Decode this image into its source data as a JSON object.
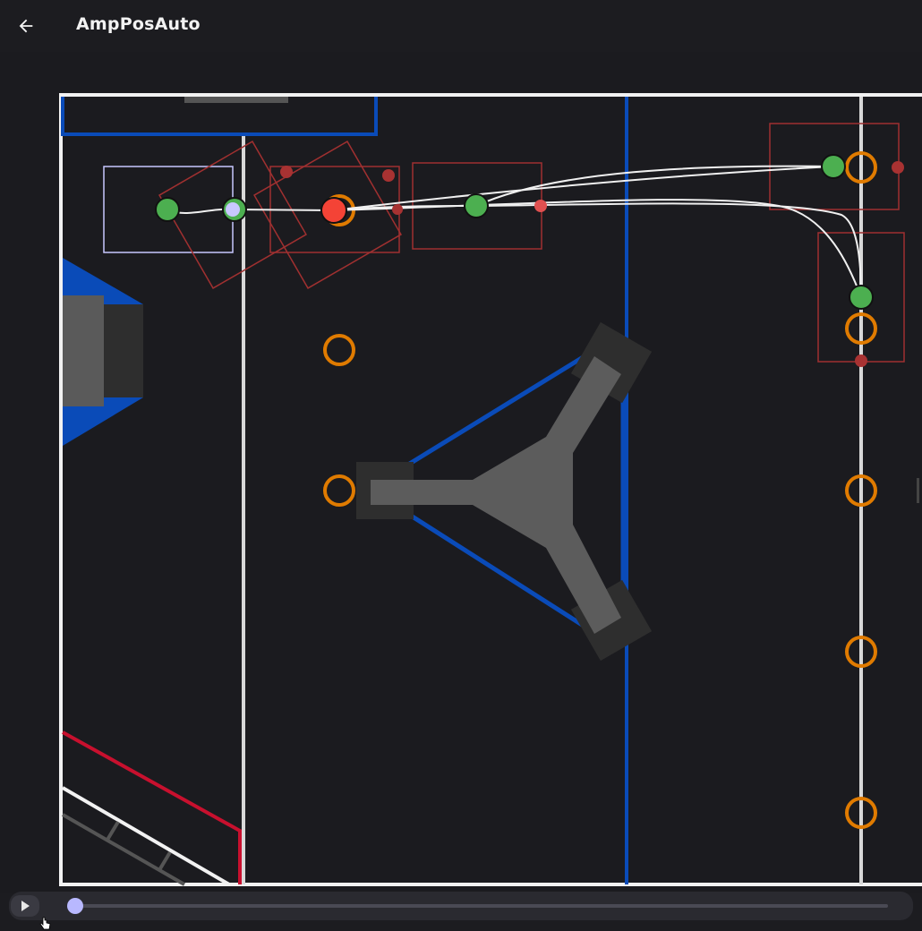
{
  "app": {
    "title": "AmpPosAuto",
    "back_icon": "arrow-left-icon"
  },
  "playback": {
    "play_icon": "play-icon",
    "progress": 0.0
  },
  "colors": {
    "background": "#1b1b1f",
    "field_lines": "#f2f2f2",
    "blue_alliance": "#0a4bb8",
    "red_alliance": "#c8102e",
    "waypoint_green": "#4caf50",
    "waypoint_red": "#e53935",
    "note_orange": "#e07b00",
    "path_white": "#f0f0f0",
    "robot_outline": "#b84040",
    "start_marker": "#c8c8ff"
  },
  "field": {
    "notes": 8,
    "waypoints": 6
  }
}
